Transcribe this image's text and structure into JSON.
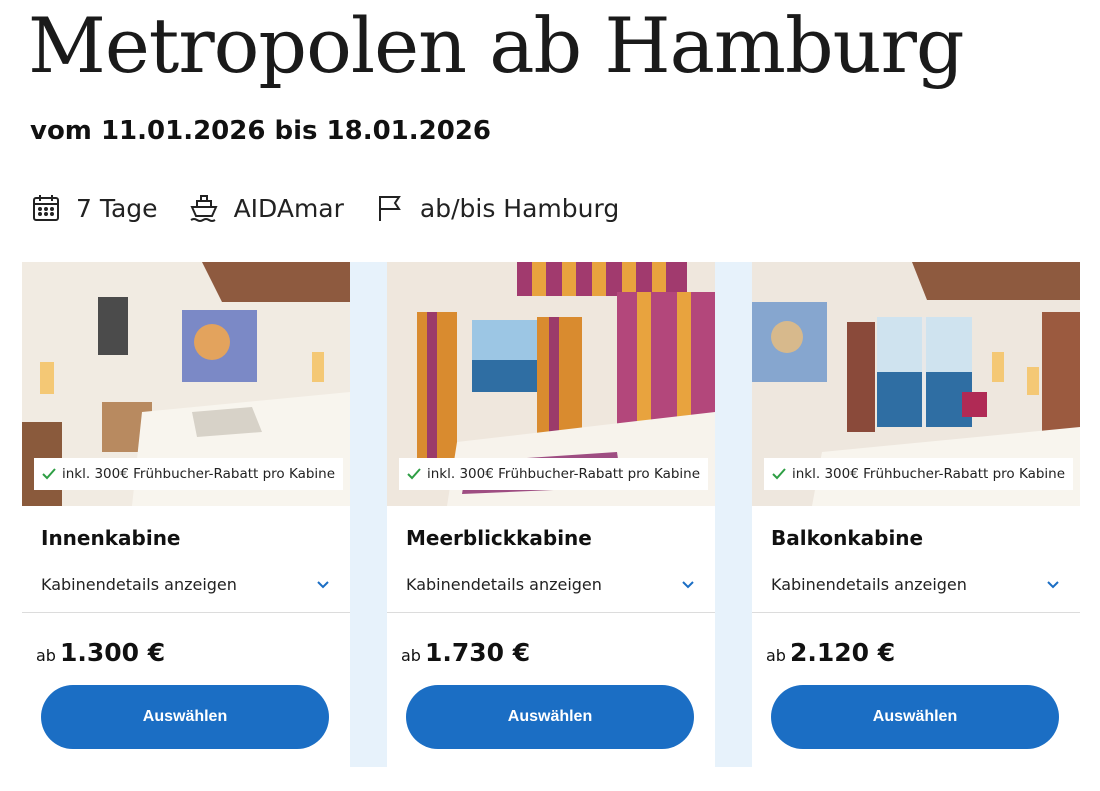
{
  "header": {
    "title": "Metropolen ab Hamburg",
    "dates": "vom 11.01.2026 bis 18.01.2026"
  },
  "meta": {
    "duration": "7 Tage",
    "ship": "AIDAmar",
    "route": "ab/bis Hamburg",
    "icons": [
      "calendar-icon",
      "ship-icon",
      "flag-icon"
    ]
  },
  "cabins": [
    {
      "badge": "inkl. 300€ Frühbucher-Rabatt pro Kabine",
      "name": "Innenkabine",
      "details_label": "Kabinendetails anzeigen",
      "price_prefix": "ab",
      "price": "1.300 €",
      "button": "Auswählen"
    },
    {
      "badge": "inkl. 300€ Frühbucher-Rabatt pro Kabine",
      "name": "Meerblickkabine",
      "details_label": "Kabinendetails anzeigen",
      "price_prefix": "ab",
      "price": "1.730 €",
      "button": "Auswählen"
    },
    {
      "badge": "inkl. 300€ Frühbucher-Rabatt pro Kabine",
      "name": "Balkonkabine",
      "details_label": "Kabinendetails anzeigen",
      "price_prefix": "ab",
      "price": "2.120 €",
      "button": "Auswählen"
    }
  ],
  "colors": {
    "button": "#1b6ec4",
    "check": "#2e9e44",
    "chevron": "#1b6ec4",
    "band": "#e7f2fb"
  }
}
